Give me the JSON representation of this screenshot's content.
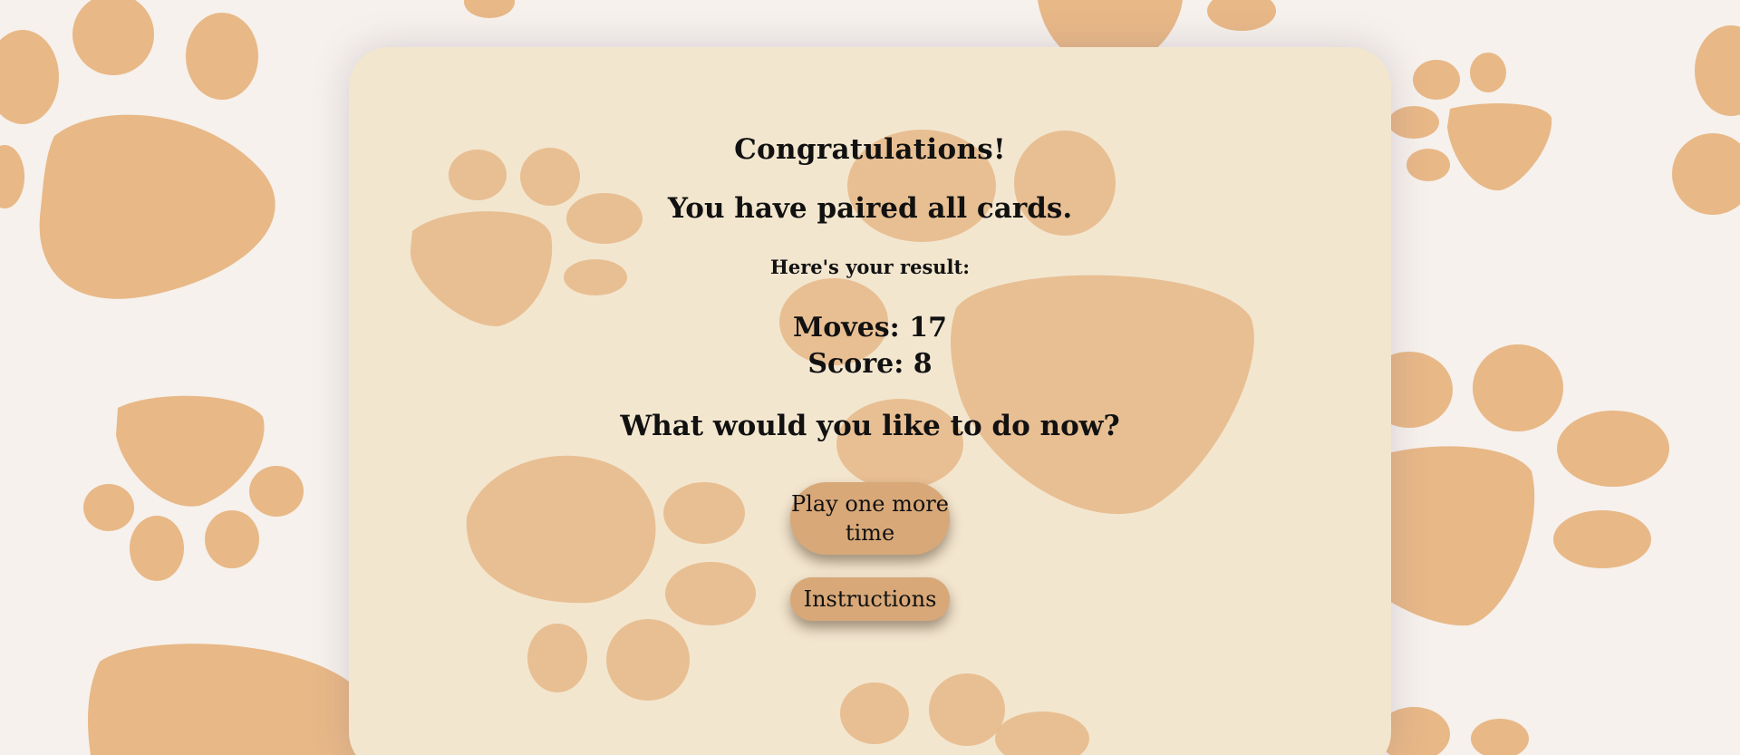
{
  "background": {
    "color": "#f6f1ec",
    "paw_color": "#e8b887",
    "icon": "paw-print-icon"
  },
  "result_card": {
    "background": "#f3e6cf",
    "heading": "Congratulations!",
    "subheading": "You have paired all cards.",
    "result_label": "Here's your result:",
    "moves": "Moves: 17",
    "score": "Score: 8",
    "question": "What would you like to do now?"
  },
  "actions": {
    "play_again_label": "Play one more time",
    "instructions_label": "Instructions",
    "button_color": "#d8a878"
  }
}
